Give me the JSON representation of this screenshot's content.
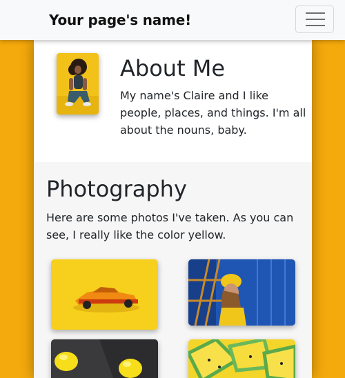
{
  "navbar": {
    "brand": "Your page's name!",
    "toggler_icon": "hamburger-menu-icon"
  },
  "about": {
    "title": "About Me",
    "text": "My name's Claire and I like people, places, and things. I'm all about the nouns, baby.",
    "profile_image": "woman-yellow-background-photo"
  },
  "photography": {
    "title": "Photography",
    "text": "Here are some photos I've taken. As you can see, I really like the color yellow.",
    "photos": [
      {
        "subject": "yellow-toy-car-photo"
      },
      {
        "subject": "woman-yellow-beanie-blue-stairs-photo"
      },
      {
        "subject": "lemons-on-slate-photo"
      },
      {
        "subject": "yellow-watermelon-slices-photo"
      }
    ]
  },
  "colors": {
    "page_background": "#f4a90c",
    "navbar": "#f8f9fa",
    "section_background": "#f6f6f6"
  }
}
